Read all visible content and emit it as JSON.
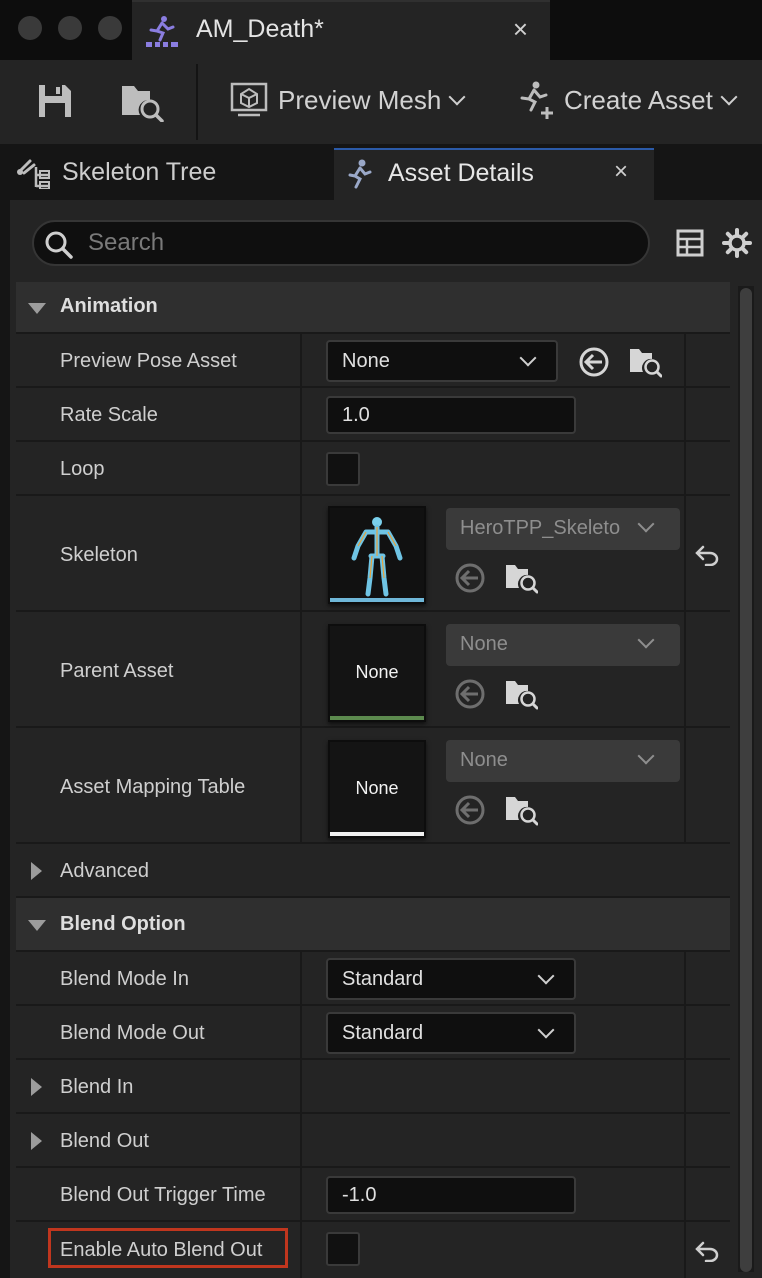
{
  "window": {
    "tab_title": "AM_Death*",
    "tab_close": "×"
  },
  "toolbar": {
    "save_icon": "save-icon",
    "browse_icon": "browse-folder-icon",
    "preview_mesh_label": "Preview Mesh",
    "create_asset_label": "Create Asset"
  },
  "panel_tabs": {
    "skeleton_tree": "Skeleton Tree",
    "asset_details": "Asset Details",
    "close": "×"
  },
  "search": {
    "placeholder": "Search"
  },
  "sections": {
    "animation": "Animation",
    "advanced": "Advanced",
    "blend_option": "Blend Option",
    "blend_in": "Blend In",
    "blend_out": "Blend Out"
  },
  "properties": {
    "preview_pose_asset": {
      "label": "Preview Pose Asset",
      "value": "None"
    },
    "rate_scale": {
      "label": "Rate Scale",
      "value": "1.0"
    },
    "loop": {
      "label": "Loop",
      "checked": false
    },
    "skeleton": {
      "label": "Skeleton",
      "value": "HeroTPP_Skeleto"
    },
    "parent_asset": {
      "label": "Parent Asset",
      "thumb": "None",
      "value": "None"
    },
    "asset_mapping_table": {
      "label": "Asset Mapping Table",
      "thumb": "None",
      "value": "None"
    },
    "blend_mode_in": {
      "label": "Blend Mode In",
      "value": "Standard"
    },
    "blend_mode_out": {
      "label": "Blend Mode Out",
      "value": "Standard"
    },
    "blend_out_trigger_time": {
      "label": "Blend Out Trigger Time",
      "value": "-1.0"
    },
    "enable_auto_blend_out": {
      "label": "Enable Auto Blend Out",
      "checked": false
    }
  },
  "colors": {
    "highlight": "#c0361e",
    "active_tab": "#2b5aa8",
    "skeleton_strip": "#6fb7d8",
    "parent_strip": "#5c8a4e",
    "mapping_strip": "#f0f0f0"
  }
}
